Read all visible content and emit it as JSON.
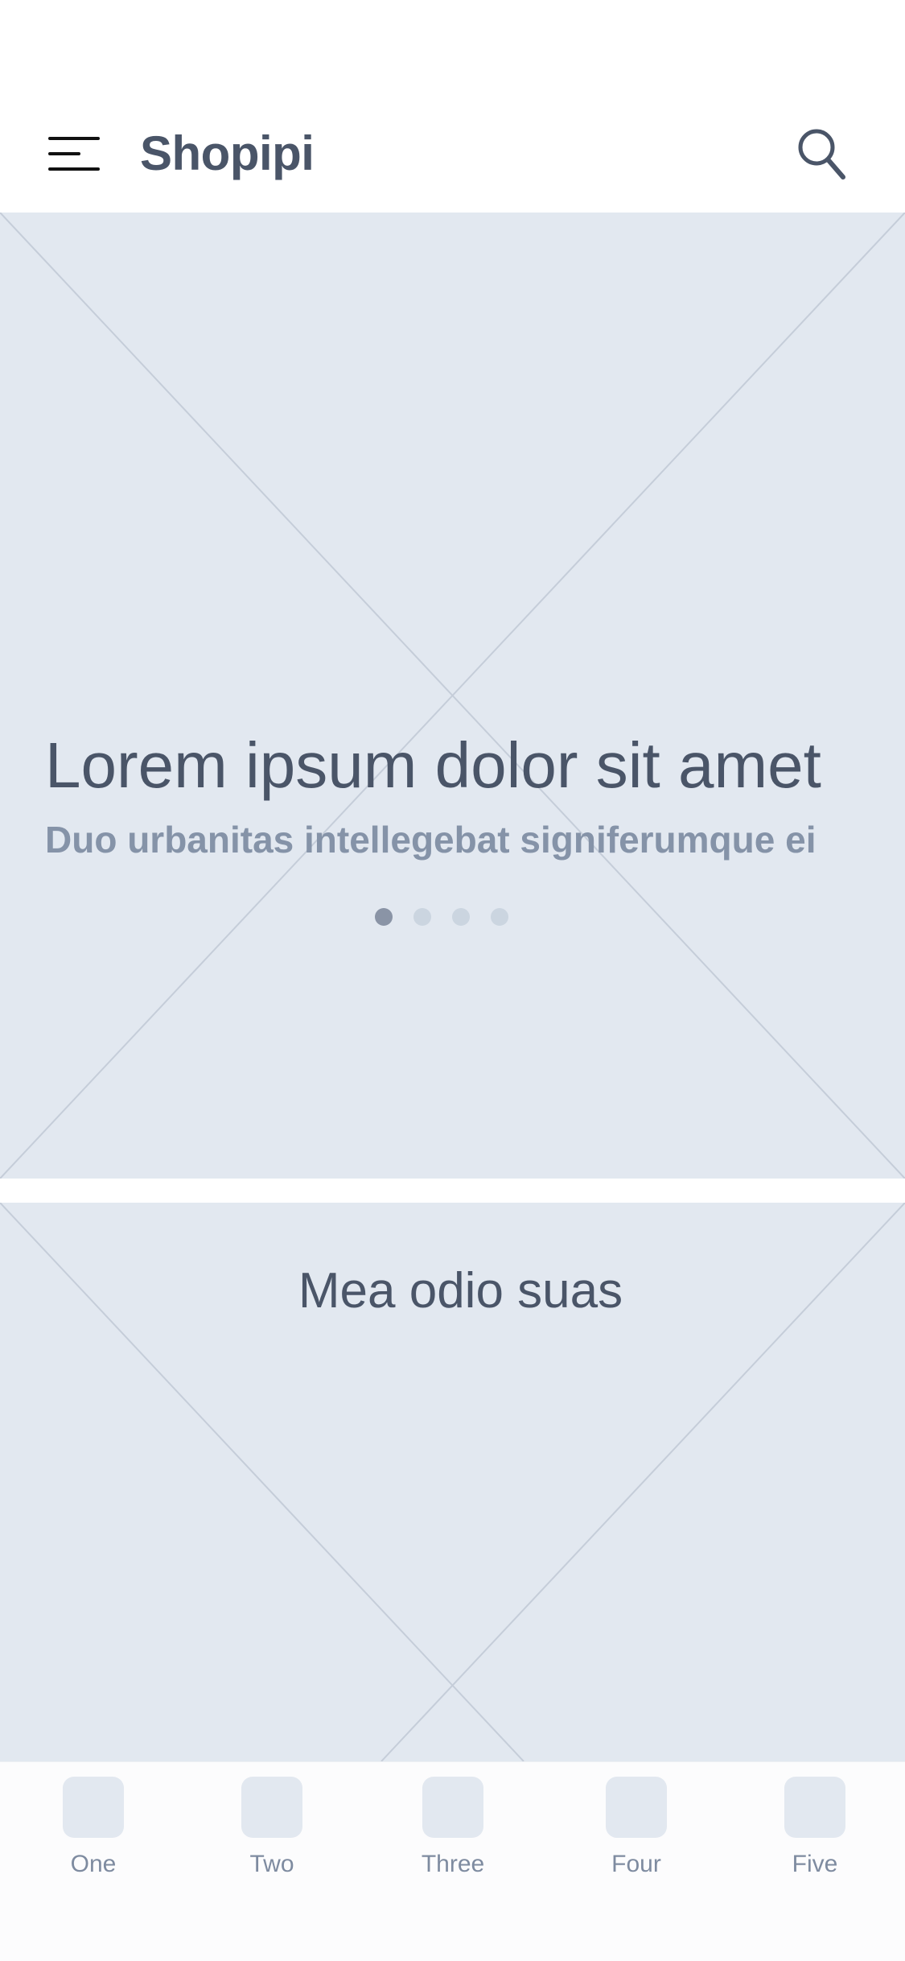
{
  "app_bar": {
    "title": "Shopipi",
    "menu_icon": "hamburger-menu-icon",
    "search_icon": "search-icon"
  },
  "hero": {
    "title": "Lorem ipsum dolor sit amet",
    "subtitle": "Duo urbanitas intellegebat signiferumque ei",
    "pager": {
      "count": 4,
      "active_index": 0
    }
  },
  "promo": {
    "title": "Mea odio suas"
  },
  "tab_bar": {
    "tabs": [
      {
        "label": "One"
      },
      {
        "label": "Two"
      },
      {
        "label": "Three"
      },
      {
        "label": "Four"
      },
      {
        "label": "Five"
      }
    ]
  },
  "colors": {
    "placeholder_bg": "#e2e8f0",
    "placeholder_lines": "#c5cdd9",
    "text_primary": "#4a5568",
    "text_secondary": "#8593a8",
    "pager_active": "#8a94a6",
    "pager_inactive": "#cbd5e0"
  }
}
